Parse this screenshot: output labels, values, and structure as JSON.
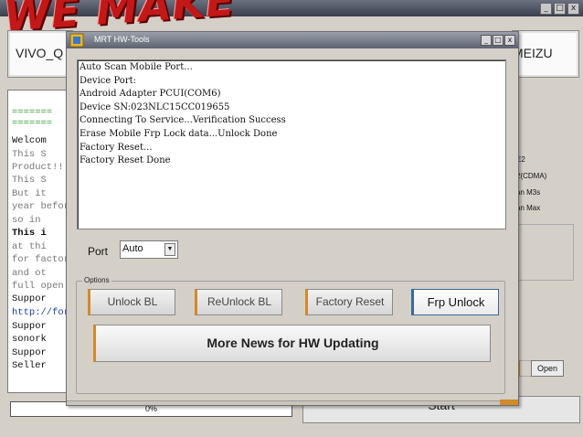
{
  "background_window": {
    "banner_text": "WE MAKE",
    "controls": [
      "_",
      "□",
      "x"
    ],
    "brands": [
      "VIVO_Q",
      "MEIZU"
    ],
    "console_lines": [
      "=======",
      "=======",
      "  Welcom",
      "   This S",
      "Product!!!",
      "   This S",
      "   But it",
      "year befor",
      "   so in",
      "   This i",
      "   at thi",
      "for factor",
      "   and ot",
      "full open",
      "   Suppor",
      "http://for",
      "   Suppor",
      "   sonork",
      "   Suppor",
      "   Seller"
    ],
    "right_panel_items": [
      "E2",
      "2(CDMA)",
      "an M3s",
      "an Max"
    ],
    "open_button": "Open",
    "progress_text": "0%",
    "start_button": "Start"
  },
  "dialog": {
    "title": "MRT HW-Tools",
    "controls": [
      "_",
      "□",
      "x"
    ],
    "log_lines": [
      "Auto Scan Mobile Port...",
      "Device Port:",
      "Android Adapter PCUI(COM6)",
      "Device SN:023NLC15CC019655",
      "Connecting To Service...Verification Success",
      "Erase Mobile Frp Lock data...Unlock Done",
      "Factory Reset...",
      "Factory Reset Done"
    ],
    "port_label": "Port",
    "port_value": "Auto",
    "options_legend": "Options",
    "buttons": {
      "unlock_bl": "Unlock BL",
      "reunlock_bl": "ReUnlock BL",
      "factory_reset": "Factory Reset",
      "frp_unlock": "Frp Unlock",
      "more_news": "More News for HW Updating"
    }
  },
  "colors": {
    "accent_orange": "#d28a2a",
    "focus_blue": "#3a6a9a",
    "banner_red": "#c21818"
  }
}
